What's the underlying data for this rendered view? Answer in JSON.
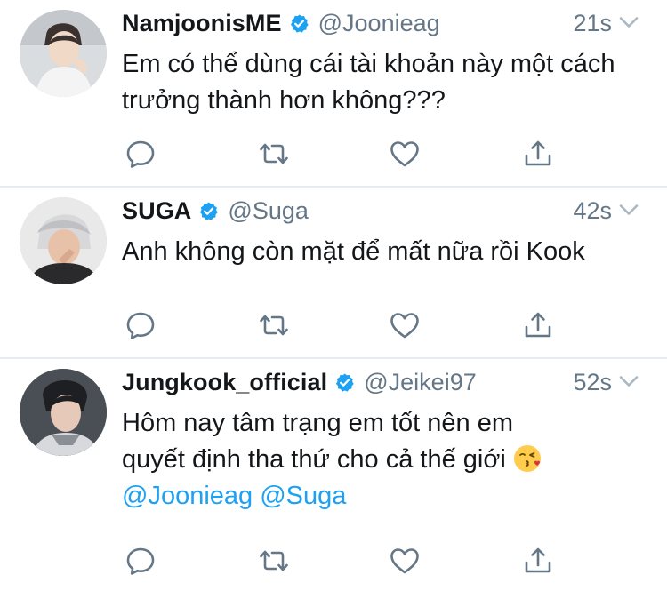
{
  "colors": {
    "text": "#14171a",
    "secondary": "#657786",
    "mention": "#1da1f2",
    "verified": "#1da1f2",
    "divider": "#e6ecf0"
  },
  "tweets": [
    {
      "name": "NamjoonisME",
      "verified": true,
      "handle": "@Joonieag",
      "time": "21s",
      "text": "Em có thể dùng cái tài khoản này một cách trưởng thành hơn không???",
      "actions": [
        "reply-icon",
        "retweet-icon",
        "like-icon",
        "share-icon"
      ]
    },
    {
      "name": "SUGA",
      "verified": true,
      "handle": "@Suga",
      "time": "42s",
      "text": "Anh không còn mặt để mất nữa rồi Kook",
      "actions": [
        "reply-icon",
        "retweet-icon",
        "like-icon",
        "share-icon"
      ]
    },
    {
      "name": "Jungkook_official",
      "verified": true,
      "handle": "@Jeikei97",
      "time": "52s",
      "text_line1": "Hôm nay tâm trạng em tốt nên em",
      "text_line2": "quyết định tha thứ cho cả thế giới",
      "emoji": "kissing-face-emoji",
      "mention_1": "@Joonieag",
      "mention_2": "@Suga",
      "actions": [
        "reply-icon",
        "retweet-icon",
        "like-icon",
        "share-icon"
      ]
    }
  ]
}
